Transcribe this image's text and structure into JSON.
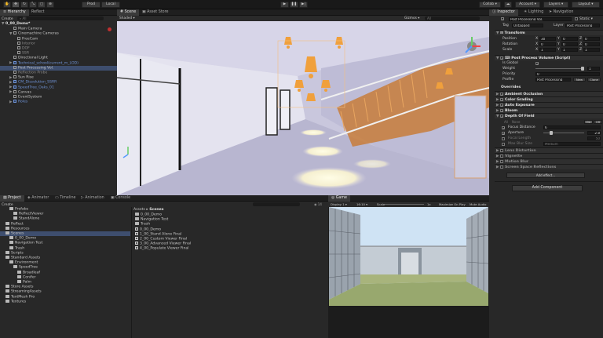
{
  "toolbar": {
    "prod_label": "Prod",
    "local_label": "Local",
    "collab_label": "Collab",
    "account_label": "Account",
    "layers_label": "Layers",
    "layout_label": "Layout"
  },
  "hierarchy": {
    "tab_label": "Hierarchy",
    "tab2_label": "Reflect",
    "create_label": "Create",
    "search_placeholder": "All",
    "rows": [
      {
        "label": "0_00_Demo*",
        "indent": 0,
        "style": "bold",
        "fold": "▼"
      },
      {
        "label": "Main Camera",
        "indent": 2,
        "style": "normal",
        "fold": ""
      },
      {
        "label": "Cinemachine Cameras",
        "indent": 2,
        "style": "normal",
        "fold": "▼"
      },
      {
        "label": "FreeCam",
        "indent": 3,
        "style": "normal",
        "fold": ""
      },
      {
        "label": "Interior",
        "indent": 3,
        "style": "dim",
        "fold": ""
      },
      {
        "label": "DOF",
        "indent": 3,
        "style": "dim",
        "fold": ""
      },
      {
        "label": "SSR",
        "indent": 3,
        "style": "dim",
        "fold": ""
      },
      {
        "label": "Directional Light",
        "indent": 2,
        "style": "normal",
        "fold": ""
      },
      {
        "label": "Technical_school(current_m_LOD)",
        "indent": 2,
        "style": "blue",
        "fold": "▶"
      },
      {
        "label": "Post Processing Vol.",
        "indent": 2,
        "style": "sel",
        "fold": ""
      },
      {
        "label": "Reflection Probe",
        "indent": 2,
        "style": "dim",
        "fold": ""
      },
      {
        "label": "Sun Rise",
        "indent": 2,
        "style": "normal",
        "fold": "▶"
      },
      {
        "label": "CM_Dissolution_SSRR",
        "indent": 2,
        "style": "blue",
        "fold": "▶"
      },
      {
        "label": "SpeedTree_Oaks_01",
        "indent": 2,
        "style": "blue",
        "fold": "▶"
      },
      {
        "label": "Canvas",
        "indent": 2,
        "style": "normal",
        "fold": "▶"
      },
      {
        "label": "EventSystem",
        "indent": 2,
        "style": "normal",
        "fold": ""
      },
      {
        "label": "Roles",
        "indent": 2,
        "style": "blue",
        "fold": "▶"
      }
    ]
  },
  "scene": {
    "tab_scene": "Scene",
    "tab_asset_store": "Asset Store",
    "shading_label": "Shaded",
    "gizmos_label": "Gizmos",
    "search_placeholder": "All"
  },
  "inspector": {
    "tab_inspector": "Inspector",
    "tab_lighting": "Lighting",
    "tab_navigation": "Navigation",
    "object_name": "Post Processing Vol.",
    "static_label": "Static",
    "tag_label": "Tag",
    "tag_value": "Untagged",
    "layer_label": "Layer",
    "layer_value": "Post Processing",
    "transform": {
      "title": "Transform",
      "position_label": "Position",
      "rotation_label": "Rotation",
      "scale_label": "Scale",
      "position": [
        "30",
        "0",
        "0"
      ],
      "rotation": [
        "0",
        "0",
        "0"
      ],
      "scale": [
        "1",
        "1",
        "1"
      ]
    },
    "ppv": {
      "title": "Post Process Volume (Script)",
      "is_global_label": "Is Global",
      "weight_label": "Weight",
      "weight_value": "1",
      "weight_fraction": 1.0,
      "priority_label": "Priority",
      "priority_value": "0",
      "profile_label": "Profile",
      "profile_value": "Post Processing",
      "new_label": "New",
      "clone_label": "Clone"
    },
    "overrides_label": "Overrides",
    "effects": [
      {
        "label": "Ambient Occlusion",
        "enabled": true
      },
      {
        "label": "Color Grading",
        "enabled": true
      },
      {
        "label": "Auto Exposure",
        "enabled": true
      },
      {
        "label": "Bloom",
        "enabled": true
      },
      {
        "label": "Depth Of Field",
        "enabled": true
      }
    ],
    "dof": {
      "all_label": "All",
      "none_label": "None",
      "on_label": "On",
      "off_label": "Off",
      "focus_distance_label": "Focus Distance",
      "focus_distance_value": "6",
      "aperture_label": "Aperture",
      "aperture_value": "2.8",
      "focal_length_label": "Focal Length",
      "focal_length_value": "50",
      "max_blur_label": "Max Blur Size",
      "max_blur_value": "Medium"
    },
    "disabled_effects": [
      {
        "label": "Lens Distortion"
      },
      {
        "label": "Vignette"
      },
      {
        "label": "Motion Blur"
      },
      {
        "label": "Screen Space Reflections"
      }
    ],
    "add_effect_label": "Add effect...",
    "add_component_label": "Add Component"
  },
  "project": {
    "tab_project": "Project",
    "tab_animator": "Animator",
    "tab_timeline": "Timeline",
    "tab_animation": "Animation",
    "tab_console": "Console",
    "create_label": "Create",
    "tree": [
      {
        "label": "Prefabs",
        "indent": 2
      },
      {
        "label": "ReflectViewer",
        "indent": 3
      },
      {
        "label": "StandAlone",
        "indent": 3
      },
      {
        "label": "Reflect",
        "indent": 1
      },
      {
        "label": "Resources",
        "indent": 1
      },
      {
        "label": "Scenes",
        "indent": 1,
        "sel": true
      },
      {
        "label": "0_00_Demo",
        "indent": 2
      },
      {
        "label": "Navigation Test",
        "indent": 2
      },
      {
        "label": "Trash",
        "indent": 2
      },
      {
        "label": "Scripts",
        "indent": 1
      },
      {
        "label": "Standard Assets",
        "indent": 1
      },
      {
        "label": "Environment",
        "indent": 2
      },
      {
        "label": "SpeedTree",
        "indent": 3
      },
      {
        "label": "Broadleaf",
        "indent": 4
      },
      {
        "label": "Conifer",
        "indent": 4
      },
      {
        "label": "Palm",
        "indent": 4
      },
      {
        "label": "Store Assets",
        "indent": 1
      },
      {
        "label": "StreamingAssets",
        "indent": 1
      },
      {
        "label": "TextMesh Pro",
        "indent": 1
      },
      {
        "label": "Textures",
        "indent": 1
      }
    ],
    "breadcrumb_root": "Assets",
    "breadcrumb_leaf": "Scenes",
    "files": [
      {
        "label": "0_00_Demo",
        "kind": "folder"
      },
      {
        "label": "Navigation Test",
        "kind": "folder"
      },
      {
        "label": "Trash",
        "kind": "folder"
      },
      {
        "label": "0_00_Demo",
        "kind": "scene"
      },
      {
        "label": "1_00_Stand Alone Final",
        "kind": "scene"
      },
      {
        "label": "2_00_Custom Viewer Final",
        "kind": "scene"
      },
      {
        "label": "3_00_Advanced Viewer Final",
        "kind": "scene"
      },
      {
        "label": "4_00_Populate Viewer Final",
        "kind": "scene"
      }
    ],
    "item_count": "14"
  },
  "game": {
    "tab_label": "Game",
    "display_label": "Display 1",
    "aspect_label": "16:10",
    "scale_label": "Scale",
    "scale_value": "1x",
    "maximize_label": "Maximize On Play",
    "mute_label": "Mute Audio"
  }
}
